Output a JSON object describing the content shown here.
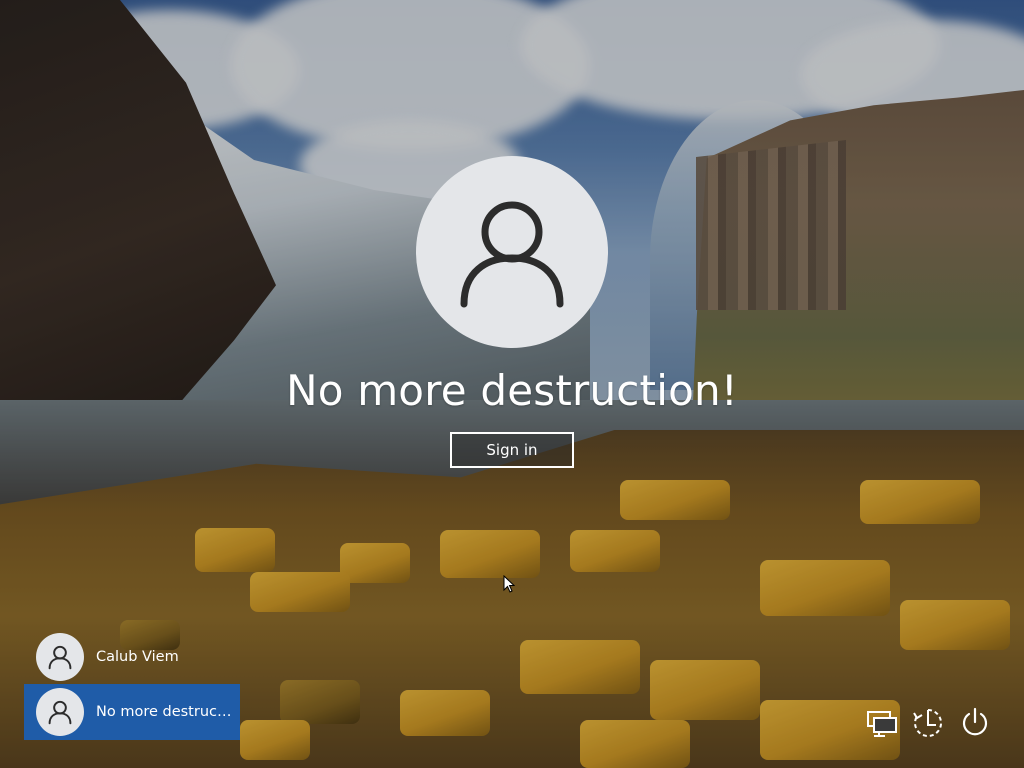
{
  "lock_screen": {
    "username": "No more destruction!",
    "sign_in_label": "Sign in"
  },
  "users": [
    {
      "name": "Calub Viem",
      "selected": false
    },
    {
      "name": "No more destructi...",
      "selected": true
    }
  ],
  "system_icons": {
    "network": "network-icon",
    "ease_of_access": "ease-of-access-icon",
    "power": "power-icon"
  },
  "colors": {
    "selected_user_bg": "#1f5ca8",
    "avatar_bg": "#e4e6e9",
    "text": "#ffffff"
  }
}
